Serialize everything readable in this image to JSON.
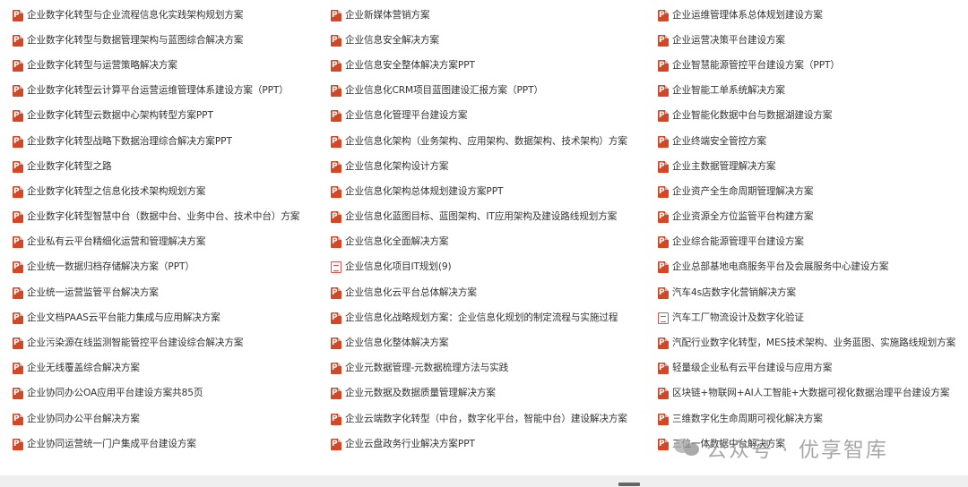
{
  "columns": [
    [
      {
        "icon": "ppt-file-icon",
        "label": "企业数字化转型与企业流程信息化实践架构规划方案"
      },
      {
        "icon": "ppt-file-icon",
        "label": "企业数字化转型与数据管理架构与蓝图综合解决方案"
      },
      {
        "icon": "ppt-file-icon",
        "label": "企业数字化转型与运营策略解决方案"
      },
      {
        "icon": "ppt-file-icon",
        "label": "企业数字化转型云计算平台运营运维管理体系建设方案（PPT）"
      },
      {
        "icon": "ppt-file-icon",
        "label": "企业数字化转型云数据中心架构转型方案PPT"
      },
      {
        "icon": "ppt-file-icon",
        "label": "企业数字化转型战略下数据治理综合解决方案PPT"
      },
      {
        "icon": "ppt-file-icon",
        "label": "企业数字化转型之路"
      },
      {
        "icon": "ppt-file-icon",
        "label": "企业数字化转型之信息化技术架构规划方案"
      },
      {
        "icon": "ppt-file-icon",
        "label": "企业数字化转型智慧中台（数据中台、业务中台、技术中台）方案"
      },
      {
        "icon": "ppt-file-icon",
        "label": "企业私有云平台精细化运营和管理解决方案"
      },
      {
        "icon": "ppt-file-icon",
        "label": "企业统一数据归档存储解决方案（PPT）"
      },
      {
        "icon": "ppt-file-icon",
        "label": "企业统一运营监管平台解决方案"
      },
      {
        "icon": "ppt-file-icon",
        "label": "企业文档PAAS云平台能力集成与应用解决方案"
      },
      {
        "icon": "ppt-file-icon",
        "label": "企业污染源在线监测智能管控平台建设综合解决方案"
      },
      {
        "icon": "ppt-file-icon",
        "label": "企业无线覆盖综合解决方案"
      },
      {
        "icon": "ppt-file-icon",
        "label": "企业协同办公OA应用平台建设方案共85页"
      },
      {
        "icon": "ppt-file-icon",
        "label": "企业协同办公平台解决方案"
      },
      {
        "icon": "ppt-file-icon",
        "label": "企业协同运营统一门户集成平台建设方案"
      }
    ],
    [
      {
        "icon": "ppt-file-icon",
        "label": "企业新媒体营销方案"
      },
      {
        "icon": "ppt-file-icon",
        "label": "企业信息安全解决方案"
      },
      {
        "icon": "ppt-file-icon",
        "label": "企业信息安全整体解决方案PPT"
      },
      {
        "icon": "ppt-file-icon",
        "label": "企业信息化CRM项目蓝图建设汇报方案（PPT）"
      },
      {
        "icon": "ppt-file-icon",
        "label": "企业信息化管理平台建设方案"
      },
      {
        "icon": "ppt-file-icon",
        "label": "企业信息化架构（业务架构、应用架构、数据架构、技术架构）方案"
      },
      {
        "icon": "ppt-file-icon",
        "label": "企业信息化架构设计方案"
      },
      {
        "icon": "ppt-file-icon",
        "label": "企业信息化架构总体规划建设方案PPT"
      },
      {
        "icon": "ppt-file-icon",
        "label": "企业信息化蓝图目标、蓝图架构、IT应用架构及建设路线规划方案"
      },
      {
        "icon": "ppt-file-icon",
        "label": "企业信息化全面解决方案"
      },
      {
        "icon": "pdf-file-icon",
        "label": "企业信息化项目IT规划(9)"
      },
      {
        "icon": "ppt-file-icon",
        "label": "企业信息化云平台总体解决方案"
      },
      {
        "icon": "ppt-file-icon",
        "label": "企业信息化战略规划方案：企业信息化规划的制定流程与实施过程"
      },
      {
        "icon": "ppt-file-icon",
        "label": "企业信息化整体解决方案"
      },
      {
        "icon": "ppt-file-icon",
        "label": "企业元数据管理-元数据梳理方法与实践"
      },
      {
        "icon": "ppt-file-icon",
        "label": "企业元数据及数据质量管理解决方案"
      },
      {
        "icon": "ppt-file-icon",
        "label": "企业云端数字化转型（中台，数字化平台，智能中台）建设解决方案"
      },
      {
        "icon": "ppt-file-icon",
        "label": "企业云盘政务行业解决方案PPT"
      }
    ],
    [
      {
        "icon": "ppt-file-icon",
        "label": "企业运维管理体系总体规划建设方案"
      },
      {
        "icon": "ppt-file-icon",
        "label": "企业运营决策平台建设方案"
      },
      {
        "icon": "ppt-file-icon",
        "label": "企业智慧能源管控平台建设方案（PPT）"
      },
      {
        "icon": "ppt-file-icon",
        "label": "企业智能工单系统解决方案"
      },
      {
        "icon": "ppt-file-icon",
        "label": "企业智能化数据中台与数据湖建设方案"
      },
      {
        "icon": "ppt-file-icon",
        "label": "企业终端安全管控方案"
      },
      {
        "icon": "ppt-file-icon",
        "label": "企业主数据管理解决方案"
      },
      {
        "icon": "ppt-file-icon",
        "label": "企业资产全生命周期管理解决方案"
      },
      {
        "icon": "ppt-file-icon",
        "label": "企业资源全方位监管平台构建方案"
      },
      {
        "icon": "ppt-file-icon",
        "label": "企业综合能源管理平台建设方案"
      },
      {
        "icon": "ppt-file-icon",
        "label": "企业总部基地电商服务平台及会展服务中心建设方案"
      },
      {
        "icon": "ppt-file-icon",
        "label": "汽车4s店数字化营销解决方案"
      },
      {
        "icon": "pdf-file-icon",
        "label": "汽车工厂物流设计及数字化验证"
      },
      {
        "icon": "ppt-file-icon",
        "label": "汽配行业数字化转型，MES技术架构、业务蓝图、实施路线规划方案"
      },
      {
        "icon": "ppt-file-icon",
        "label": "轻量级企业私有云平台建设与应用方案"
      },
      {
        "icon": "ppt-file-icon",
        "label": "区块链+物联网+AI人工智能+大数据可视化数据治理平台建设方案"
      },
      {
        "icon": "ppt-file-icon",
        "label": "三维数字化生命周期可视化解决方案"
      },
      {
        "icon": "ppt-file-icon",
        "label": "三位一体数据中台解决方案"
      }
    ]
  ],
  "watermark": {
    "text": "公众号 · 优享智库",
    "icon": "wechat-icon"
  }
}
